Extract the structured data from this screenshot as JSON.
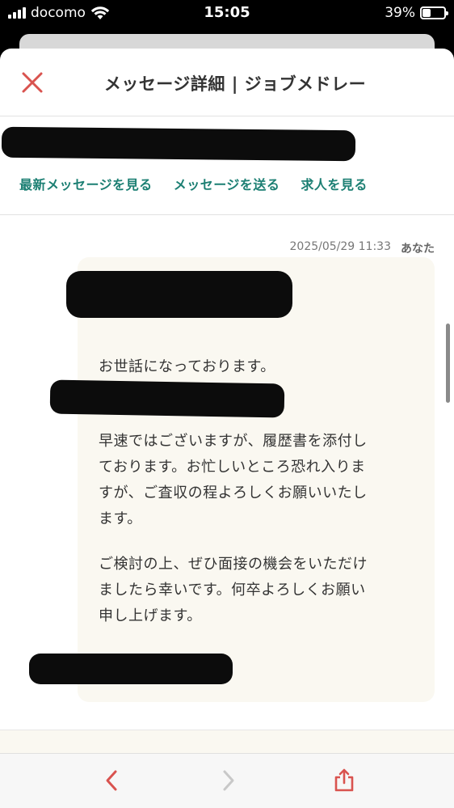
{
  "status_bar": {
    "carrier": "docomo",
    "time": "15:05",
    "battery": "39%",
    "battery_level": 0.39
  },
  "header": {
    "title": "メッセージ詳細 | ジョブメドレー",
    "close_icon": "close-icon"
  },
  "nav": {
    "links": [
      "最新メッセージを見る",
      "メッセージを送る",
      "求人を見る"
    ]
  },
  "message": {
    "timestamp": "2025/05/29 11:33",
    "sender": "あなた",
    "paragraphs": [
      "お世話になっております。",
      "早速ではございますが、履歴書を添付し\nております。お忙しいところ恐れ入りま\nすが、ご査収の程よろしくお願いいたし\nます。",
      "ご検討の上、ぜひ面接の機会をいただけ\nましたら幸いです。何卒よろしくお願い\n申し上げます。"
    ]
  },
  "toolbar": {
    "icons": [
      "back-chevron-icon",
      "forward-chevron-icon",
      "share-icon"
    ]
  },
  "colors": {
    "accent_red": "#d9534f",
    "link_teal": "#1c7f73",
    "bubble_bg": "#faf8f1"
  }
}
